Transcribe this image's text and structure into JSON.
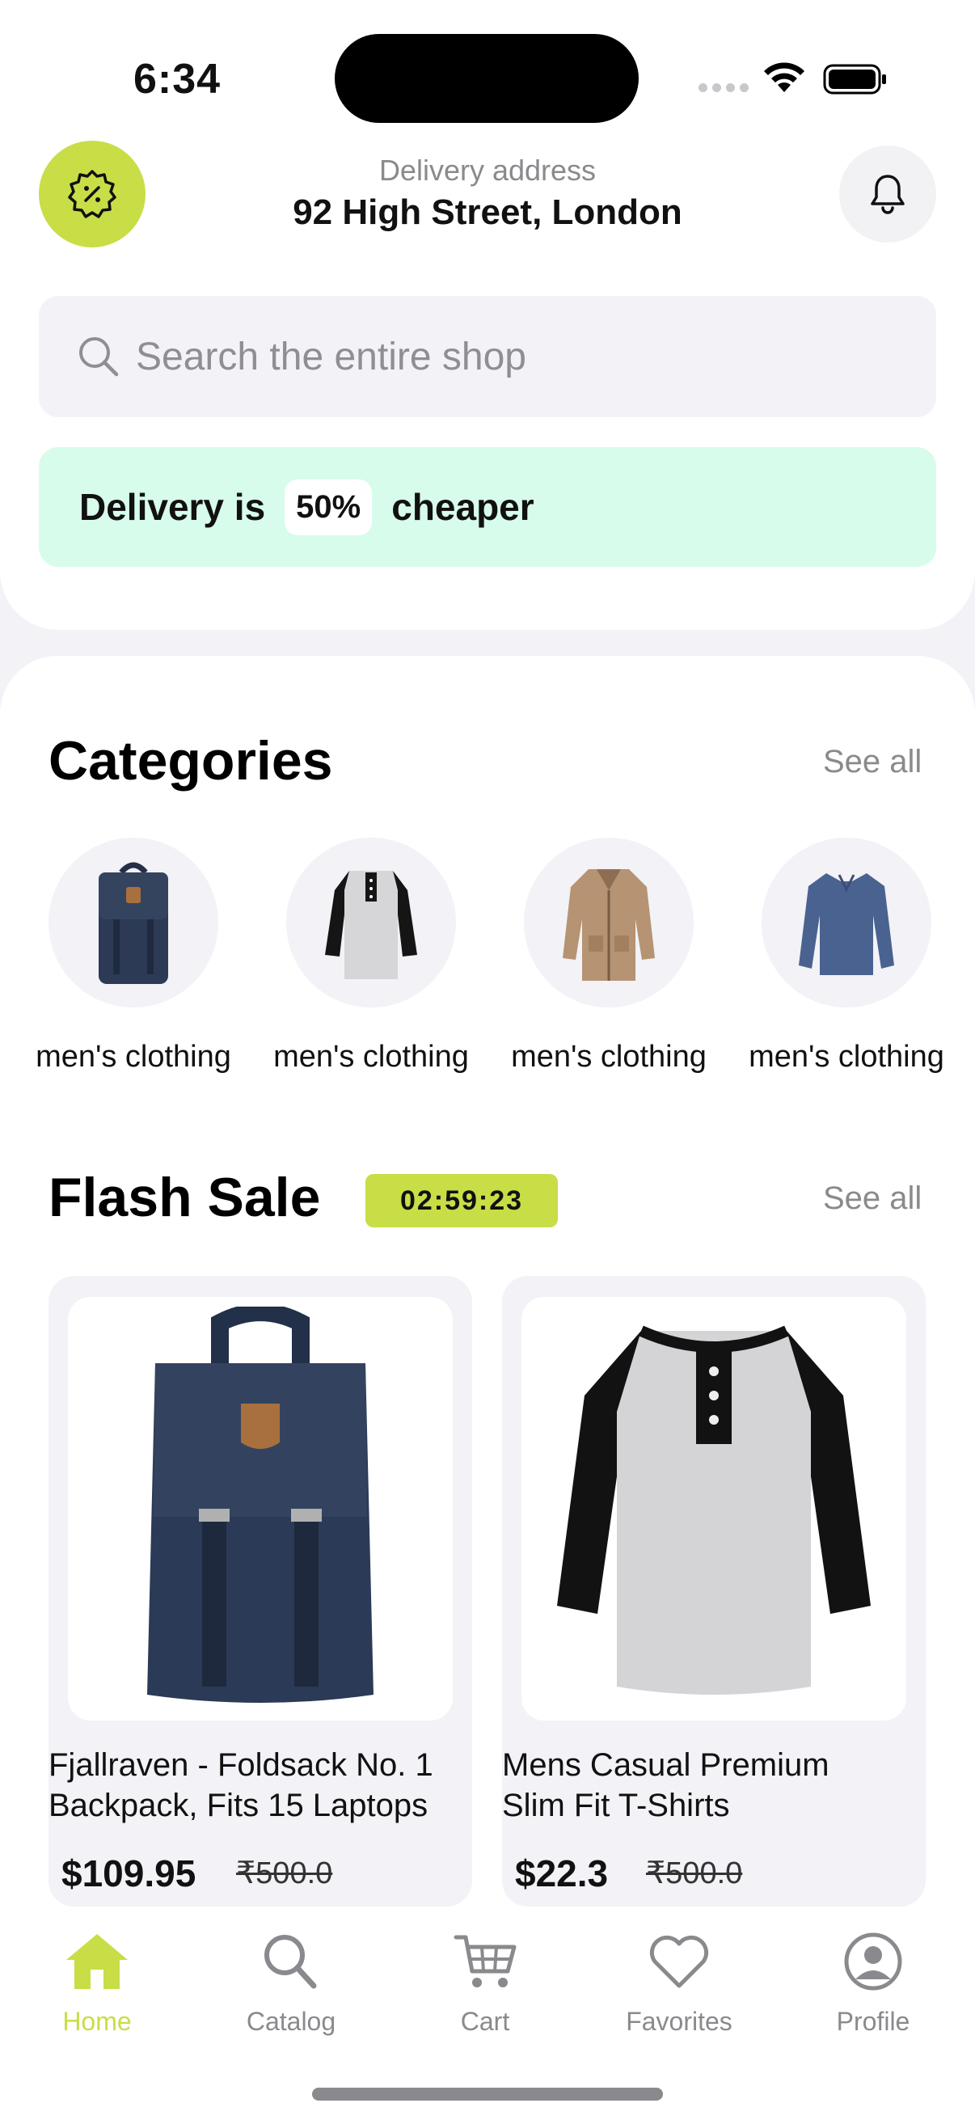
{
  "status_bar": {
    "time": "6:34"
  },
  "header": {
    "delivery_label": "Delivery address",
    "delivery_address": "92 High Street, London"
  },
  "search": {
    "placeholder": "Search the entire shop"
  },
  "banner": {
    "prefix": "Delivery is",
    "percent": "50%",
    "suffix": "cheaper"
  },
  "categories": {
    "title": "Categories",
    "see_all": "See all",
    "items": [
      {
        "label": "men's clothing",
        "icon": "backpack"
      },
      {
        "label": "men's clothing",
        "icon": "henley-shirt"
      },
      {
        "label": "men's clothing",
        "icon": "jacket"
      },
      {
        "label": "men's clothing",
        "icon": "long-sleeve-shirt"
      }
    ]
  },
  "flash_sale": {
    "title": "Flash Sale",
    "timer": "02:59:23",
    "see_all": "See all",
    "products": [
      {
        "name_line1": "Fjallraven - Foldsack No. 1",
        "name_line2": "Backpack, Fits 15 Laptops",
        "price": "$109.95",
        "old_price": "₹500.0",
        "icon": "backpack"
      },
      {
        "name_line1": "Mens Casual Premium",
        "name_line2": "Slim Fit T-Shirts",
        "price": "$22.3",
        "old_price": "₹500.0",
        "icon": "henley-shirt"
      }
    ]
  },
  "tab_bar": {
    "tabs": [
      {
        "label": "Home",
        "icon": "home-icon",
        "active": true
      },
      {
        "label": "Catalog",
        "icon": "search-icon"
      },
      {
        "label": "Cart",
        "icon": "cart-icon"
      },
      {
        "label": "Favorites",
        "icon": "heart-icon"
      },
      {
        "label": "Profile",
        "icon": "profile-icon"
      }
    ]
  },
  "colors": {
    "accent": "#C9DD46",
    "banner_bg": "#D7FCEB",
    "surface": "#F2F2F7"
  }
}
